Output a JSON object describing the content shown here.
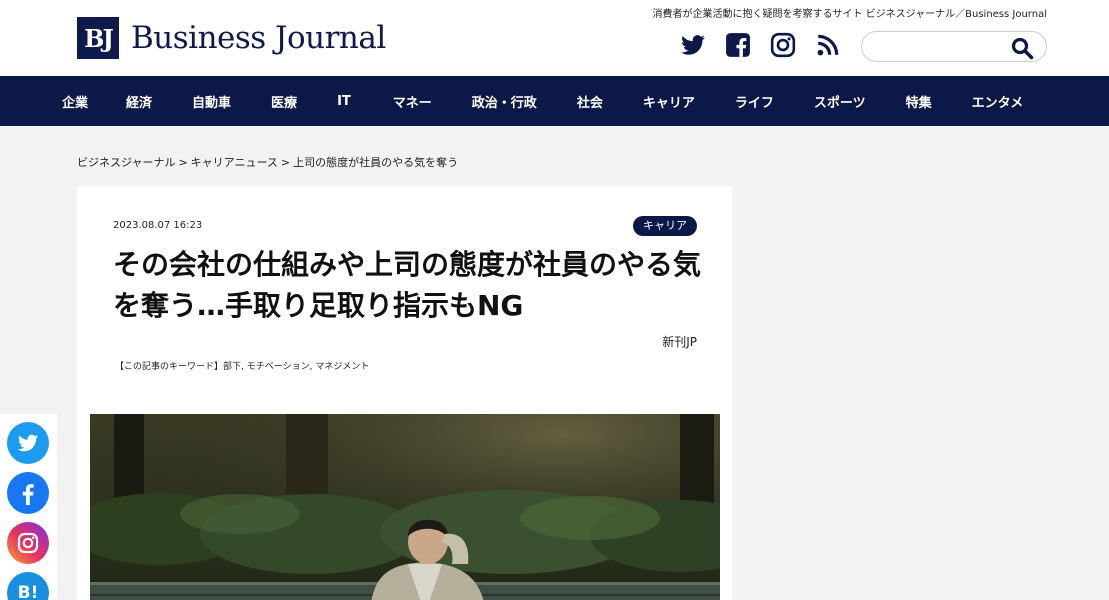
{
  "header": {
    "tagline": "消費者が企業活動に抱く疑問を考察するサイト ビジネスジャーナル／Business Journal",
    "logo_mark": "BJ",
    "logo_text": "Business Journal",
    "social_icons": [
      "twitter-icon",
      "facebook-icon",
      "instagram-icon",
      "rss-icon"
    ],
    "search_placeholder": ""
  },
  "nav": {
    "items": [
      "企業",
      "経済",
      "自動車",
      "医療",
      "IT",
      "マネー",
      "政治・行政",
      "社会",
      "キャリア",
      "ライフ",
      "スポーツ",
      "特集",
      "エンタメ"
    ]
  },
  "breadcrumb": {
    "items": [
      "ビジネスジャーナル",
      "キャリアニュース",
      "上司の態度が社員のやる気を奪う"
    ],
    "separator": ">"
  },
  "article": {
    "date": "2023.08.07 16:23",
    "category": "キャリア",
    "title": "その会社の仕組みや上司の態度が社員のやる気を奪う…手取り足取り指示もNG",
    "source": "新刊JP",
    "keywords_label": "【この記事のキーワード】",
    "keywords": [
      "部下",
      "モチベーション",
      "マネジメント"
    ]
  },
  "share": {
    "buttons": [
      "twitter-share",
      "facebook-share",
      "instagram-share",
      "hatena-share"
    ],
    "hatena_label": "B!"
  },
  "colors": {
    "navy": "#0c1948",
    "twitter": "#1d9bf0",
    "facebook": "#1877f2"
  }
}
